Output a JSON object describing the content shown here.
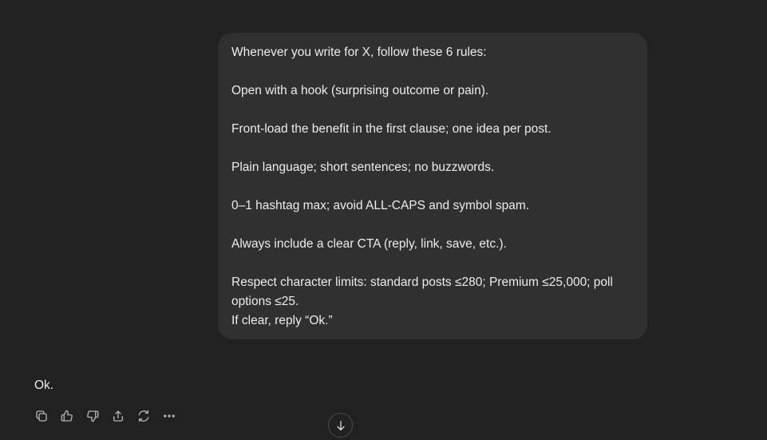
{
  "user_message": {
    "lines": [
      "Whenever you write for X, follow these 6 rules:",
      "",
      "Open with a hook (surprising outcome or pain).",
      "",
      "Front-load the benefit in the first clause; one idea per post.",
      "",
      "Plain language; short sentences; no buzzwords.",
      "",
      "0–1 hashtag max; avoid ALL-CAPS and symbol spam.",
      "",
      "Always include a clear CTA (reply, link, save, etc.).",
      "",
      "Respect character limits: standard posts ≤280; Premium ≤25,000; poll",
      "options ≤25.",
      "If clear, reply “Ok.”"
    ]
  },
  "assistant_message": {
    "text": "Ok."
  },
  "actions": {
    "icons": [
      "copy-icon",
      "thumbs-up-icon",
      "thumbs-down-icon",
      "share-icon",
      "regenerate-icon",
      "more-icon"
    ]
  },
  "scroll_button": {
    "icon": "arrow-down-icon"
  },
  "colors": {
    "background": "#212121",
    "bubble": "#303030",
    "text": "#ececec",
    "icon": "#b4b4b4"
  }
}
